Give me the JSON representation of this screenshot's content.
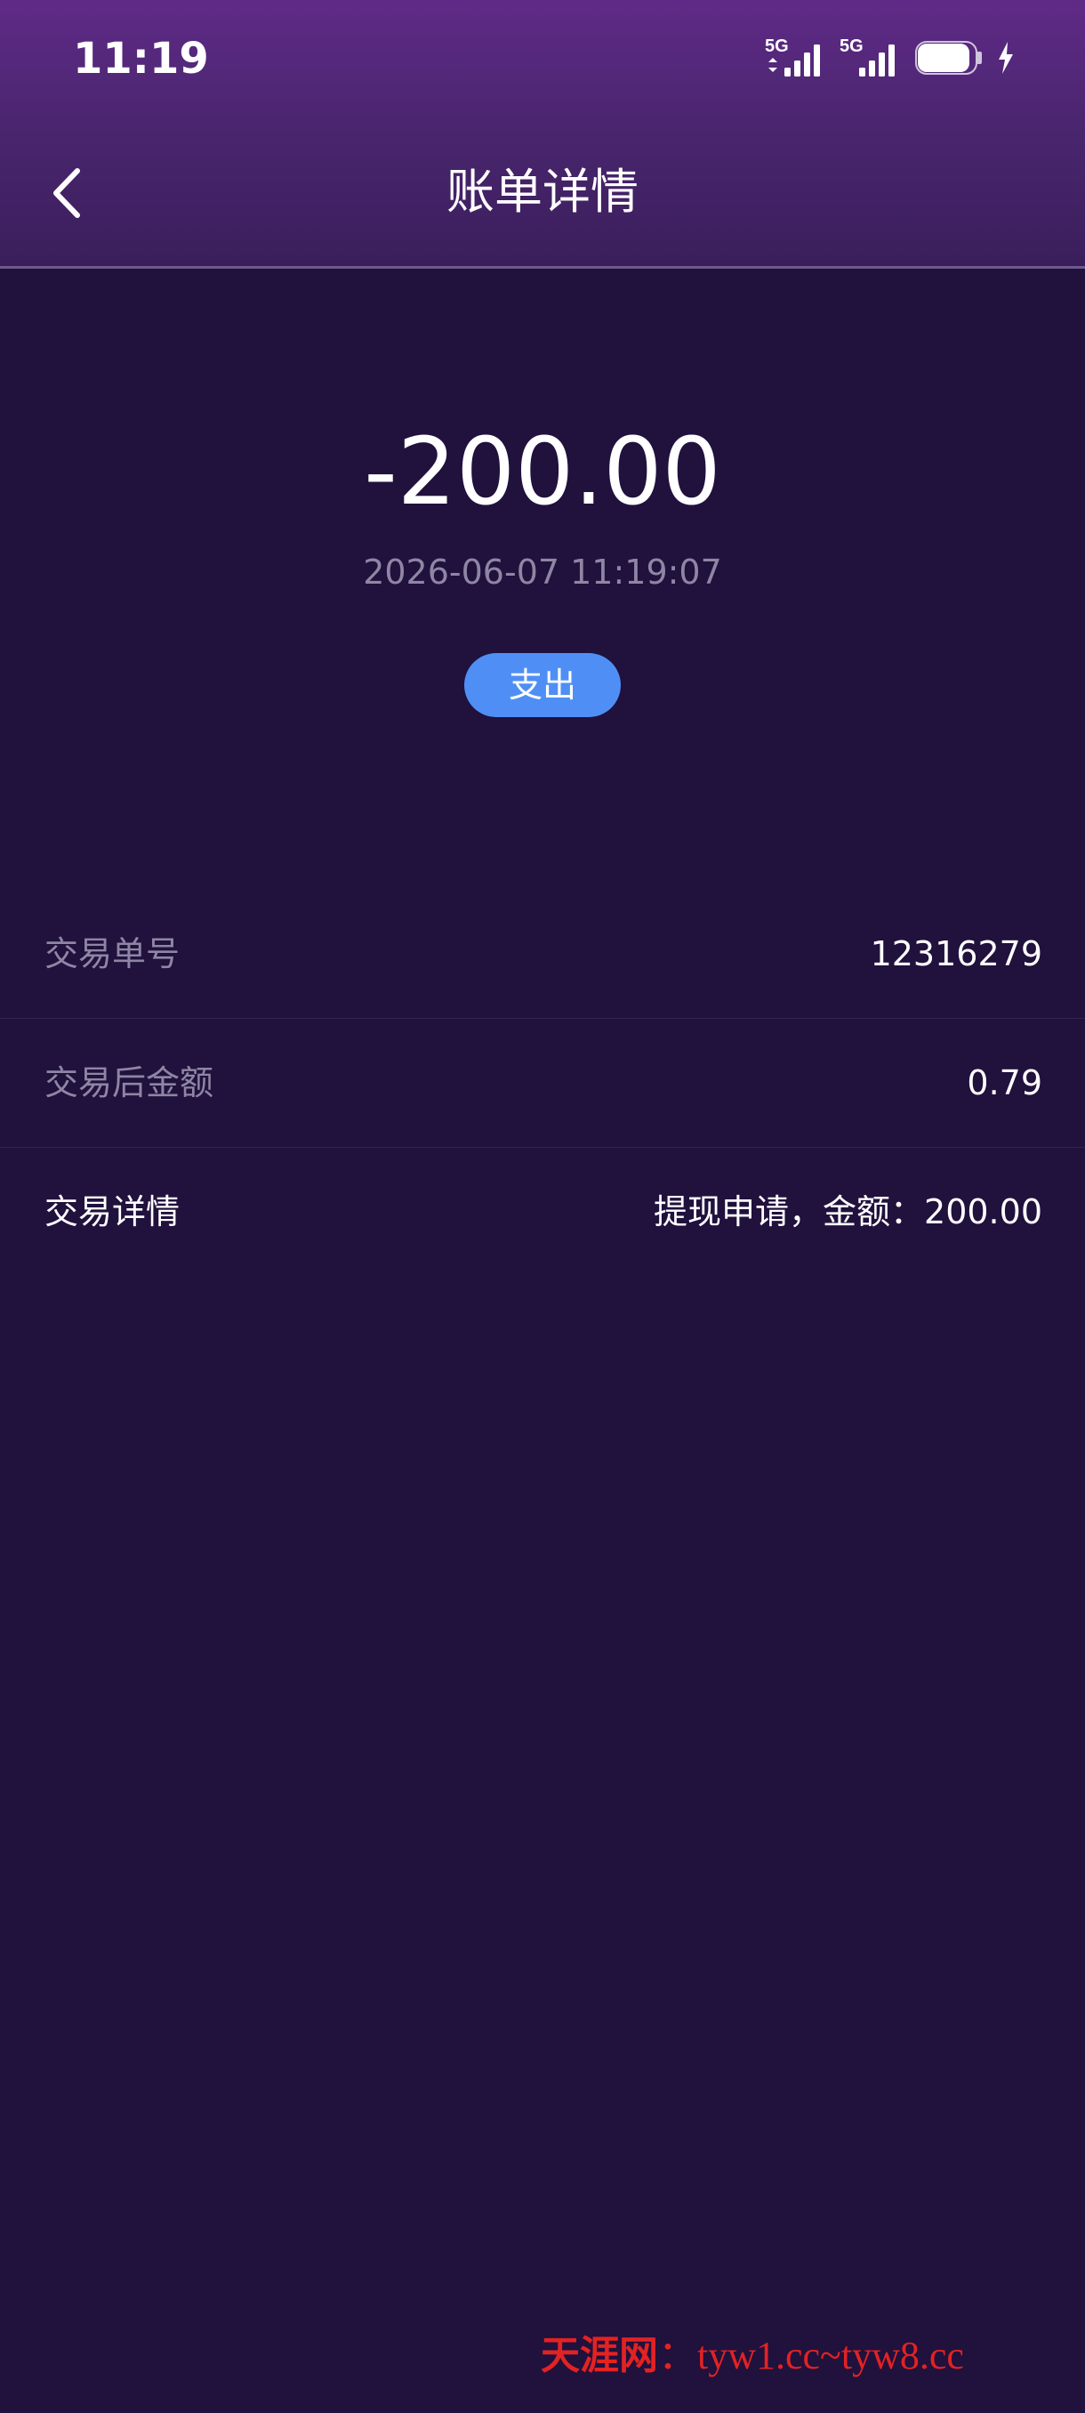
{
  "status_bar": {
    "time": "11:19",
    "sim1_label": "5G",
    "sim2_label": "5G",
    "icons": [
      "signal-5g-icon",
      "signal-5g-icon",
      "battery-icon",
      "charging-icon"
    ]
  },
  "header": {
    "title": "账单详情",
    "back_icon": "chevron-left-icon"
  },
  "summary": {
    "amount": "-200.00",
    "datetime": "2026-06-07 11:19:07",
    "type_badge": "支出",
    "badge_color": "#4f8ff5"
  },
  "details": [
    {
      "label": "交易单号",
      "value": "12316279"
    },
    {
      "label": "交易后金额",
      "value": "0.79"
    },
    {
      "label": "交易详情",
      "value": "提现申请，金额：200.00"
    }
  ],
  "watermark": {
    "brand": "天涯网",
    "separator": "：",
    "url": "tyw1.cc~tyw8.cc"
  },
  "colors": {
    "background": "#20113d",
    "header_top": "#5f2a87",
    "muted_text": "#8e86a4",
    "watermark": "#e32222"
  }
}
